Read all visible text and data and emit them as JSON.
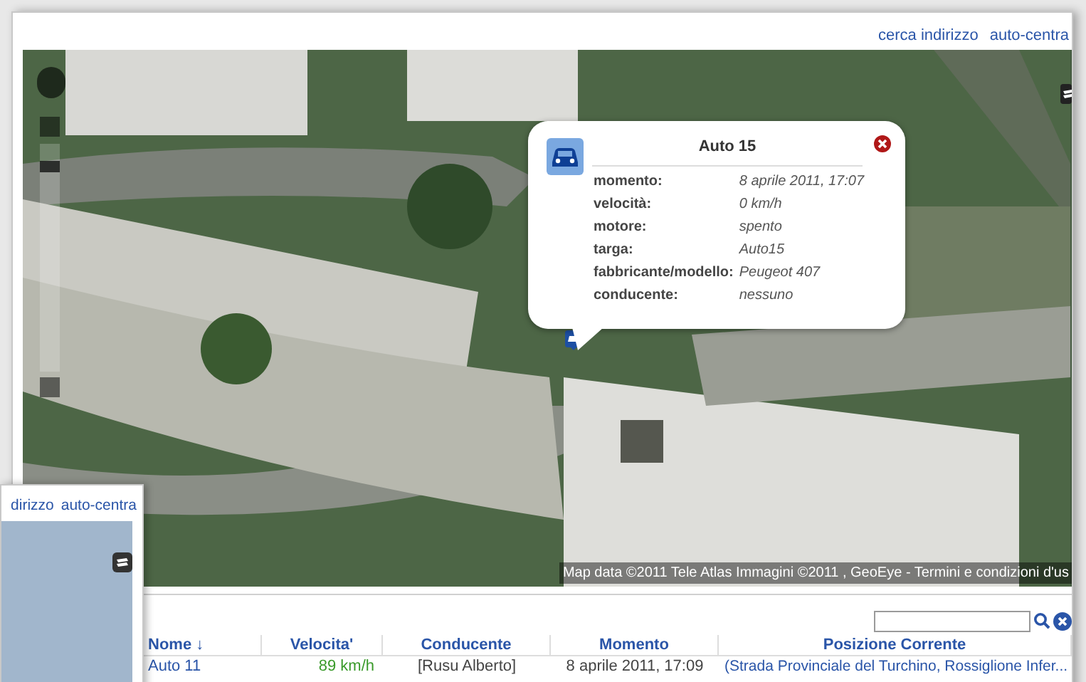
{
  "toolbar_links": [
    {
      "label": "cerca indirizzo"
    },
    {
      "label": "auto-centra"
    }
  ],
  "map": {
    "zoom": {
      "level": 0.92
    },
    "attribution": "Map data ©2011 Tele Atlas Immagini ©2011 , GeoEye - Termini e condizioni d'us"
  },
  "popup": {
    "title": "Auto 15",
    "fields": [
      {
        "label": "momento:",
        "value": "8 aprile 2011, 17:07"
      },
      {
        "label": "velocità:",
        "value": "0 km/h"
      },
      {
        "label": "motore:",
        "value": "spento"
      },
      {
        "label": "targa:",
        "value": "Auto15"
      },
      {
        "label": "fabbricante/modello:",
        "value": "Peugeot 407"
      },
      {
        "label": "conducente:",
        "value": "nessuno"
      }
    ]
  },
  "table": {
    "columns": [
      {
        "label": "Nome ↓"
      },
      {
        "label": "Velocita'"
      },
      {
        "label": "Conducente"
      },
      {
        "label": "Momento"
      },
      {
        "label": "Posizione Corrente"
      }
    ],
    "rows": [
      {
        "cells": [
          "Auto 11",
          "89 km/h",
          "[Rusu Alberto]",
          "8 aprile 2011, 17:09",
          "(Strada Provinciale del Turchino, Rossiglione Infer..."
        ]
      }
    ]
  },
  "overlay_window": {
    "links": [
      {
        "label": "dirizzo"
      },
      {
        "label": "auto-centra"
      }
    ]
  }
}
